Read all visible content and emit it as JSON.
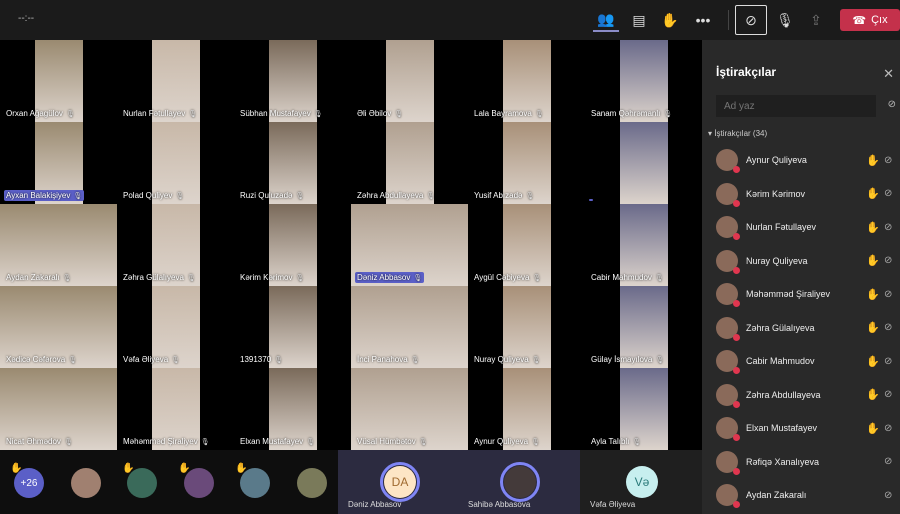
{
  "topbar": {
    "timer": "--:--",
    "leave_label": "Çıx",
    "icons": [
      "participants-icon",
      "chat-icon",
      "raise-hand-icon",
      "more-icon",
      "camera-off-icon",
      "mic-off-icon",
      "share-screen-icon",
      "phone-hangup-icon"
    ]
  },
  "grid": {
    "tiles": [
      {
        "name": "Orxan Ağagülov"
      },
      {
        "name": "Nurlan Fətullayev"
      },
      {
        "name": "Sübhan Mustafayev"
      },
      {
        "name": "Əli Əbilov"
      },
      {
        "name": "Lala Bayramova"
      },
      {
        "name": "Sanam Qəhrəmanlı"
      },
      {
        "name": "Ayxan Balakişiyev",
        "highlight": true
      },
      {
        "name": "Polad Quliyev"
      },
      {
        "name": "Ruzi Quluzadə"
      },
      {
        "name": "Zəhra Abdullayeva"
      },
      {
        "name": "Yusif Abızadə"
      },
      {
        "name": "",
        "highlight": true
      },
      {
        "name": "Aydan Zakaralı"
      },
      {
        "name": "Zəhra Gülalıyeva"
      },
      {
        "name": "Kərim Kərimov"
      },
      {
        "name": "Dəniz Abbasov",
        "highlight": true
      },
      {
        "name": "Aygül Cəbiyeva"
      },
      {
        "name": "Cabir Mahmudov"
      },
      {
        "name": "Xədicə Cəfərova"
      },
      {
        "name": "Vəfa Əliyeva"
      },
      {
        "name": "1391370"
      },
      {
        "name": "İnci Panahova"
      },
      {
        "name": "Nuray Quliyeva"
      },
      {
        "name": "Gülay İsmayılova"
      },
      {
        "name": "Nicat Əhmədov"
      },
      {
        "name": "Məhəmməd Şiraliyev"
      },
      {
        "name": "Elxan Mustafayev"
      },
      {
        "name": "Vüsal Hümbətov"
      },
      {
        "name": "Aynur Quliyeva"
      },
      {
        "name": "Ayla Talıblı"
      }
    ]
  },
  "bottom": {
    "overflow_count": "+26",
    "featured": [
      {
        "initials": "DA",
        "name": "Dəniz Abbasov"
      },
      {
        "initials": "",
        "name": "Sahibə Abbasova"
      },
      {
        "initials": "Və",
        "name": "Vəfa Əliyeva"
      }
    ]
  },
  "panel": {
    "title": "İştirakçılar",
    "search_placeholder": "Ad yaz",
    "section": "İştirakçılar (34)",
    "participants": [
      {
        "name": "Aynur Quliyeva",
        "hand": true
      },
      {
        "name": "Kərim Kərimov",
        "hand": true
      },
      {
        "name": "Nurlan Fətullayev",
        "hand": true
      },
      {
        "name": "Nuray Quliyeva",
        "hand": true
      },
      {
        "name": "Məhəmməd Şiraliyev",
        "hand": true
      },
      {
        "name": "Zəhra Gülalıyeva",
        "hand": true
      },
      {
        "name": "Cabir Mahmudov",
        "hand": true
      },
      {
        "name": "Zəhra Abdullayeva",
        "hand": true
      },
      {
        "name": "Elxan Mustafayev",
        "hand": true
      },
      {
        "name": "Rəfiqə Xanalıyeva",
        "hand": false
      },
      {
        "name": "Aydan Zakaralı",
        "hand": false
      }
    ]
  },
  "colors": {
    "accent": "#5b5fc7",
    "leave": "#c4314b",
    "hand": "#f0b73c"
  }
}
